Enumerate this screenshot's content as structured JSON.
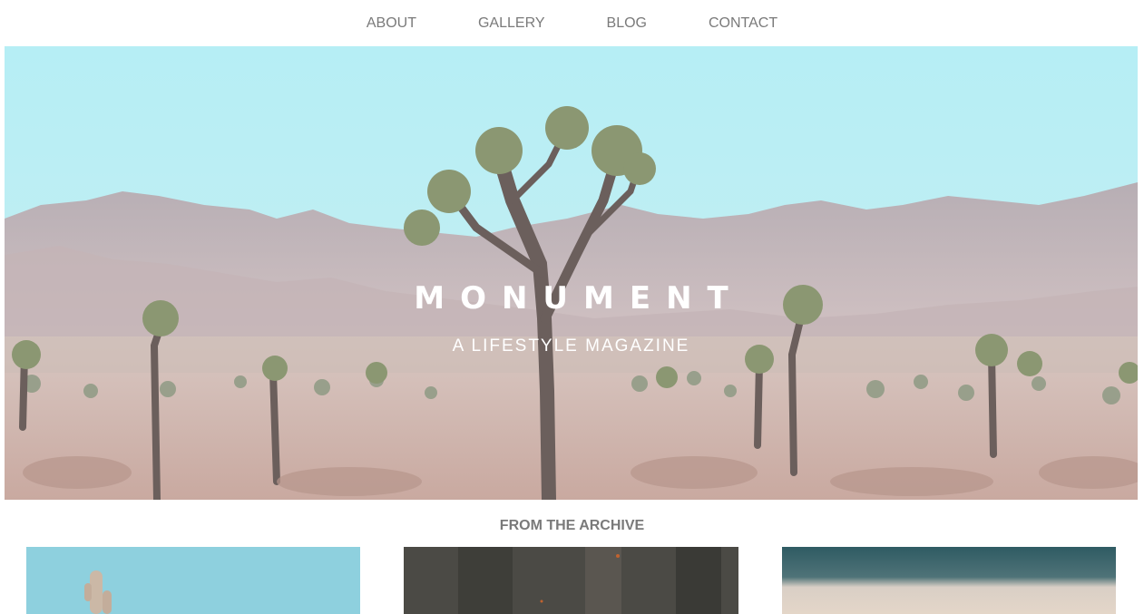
{
  "nav": {
    "items": [
      {
        "label": "ABOUT"
      },
      {
        "label": "GALLERY"
      },
      {
        "label": "BLOG"
      },
      {
        "label": "CONTACT"
      }
    ]
  },
  "hero": {
    "title": "MONUMENT",
    "subtitle": "A LIFESTYLE MAGAZINE"
  },
  "archive": {
    "heading": "FROM THE ARCHIVE"
  },
  "colors": {
    "nav_text": "#7a7a7a",
    "sky": "#b8eef4",
    "hero_text": "#ffffff"
  }
}
